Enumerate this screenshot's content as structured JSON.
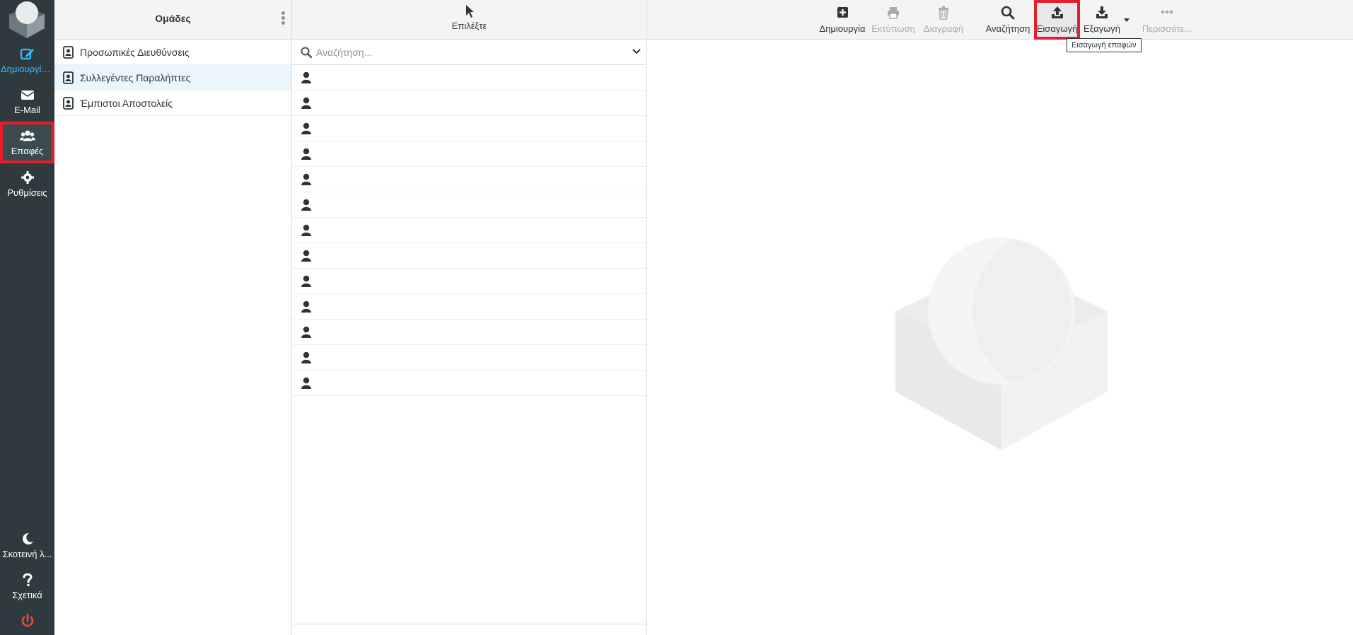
{
  "nav": {
    "items": [
      {
        "label": "Δημιουργία...",
        "icon": "compose-icon"
      },
      {
        "label": "E-Mail",
        "icon": "envelope-icon"
      },
      {
        "label": "Επαφές",
        "icon": "users-icon"
      },
      {
        "label": "Ρυθμίσεις",
        "icon": "gear-icon"
      }
    ],
    "bottom_items": [
      {
        "label": "Σκοτεινή λ...",
        "icon": "moon-icon"
      },
      {
        "label": "Σχετικά",
        "icon": "question-icon"
      },
      {
        "label": "",
        "icon": "power-icon"
      }
    ],
    "colors": {
      "background": "#2f3a3f",
      "accent": "#37beff",
      "highlight": "#e41e2a",
      "logout": "#e74c3c"
    }
  },
  "groups": {
    "title": "Ομάδες",
    "items": [
      {
        "label": "Προσωπικές Διευθύνσεις"
      },
      {
        "label": "Συλλεγέντες Παραλήπτες"
      },
      {
        "label": "Έμπιστοι Αποστολείς"
      }
    ],
    "selected_index": 1
  },
  "list": {
    "select_label": "Επιλέξτε",
    "search_placeholder": "Αναζήτηση...",
    "contacts": [
      "",
      "",
      "",
      "",
      "",
      "",
      "",
      "",
      "",
      "",
      "",
      "",
      ""
    ]
  },
  "toolbar": {
    "buttons": [
      {
        "label": "Δημιουργία",
        "icon": "plus-square-icon",
        "enabled": true
      },
      {
        "label": "Εκτύπωση",
        "icon": "printer-icon",
        "enabled": false
      },
      {
        "label": "Διαγραφή",
        "icon": "trash-icon",
        "enabled": false
      },
      {
        "label": "Αναζήτηση",
        "icon": "search-icon",
        "enabled": true
      },
      {
        "label": "Εισαγωγή",
        "icon": "upload-icon",
        "enabled": true
      },
      {
        "label": "Εξαγωγή",
        "icon": "download-icon",
        "enabled": true
      },
      {
        "label": "Περισσότε...",
        "icon": "more-icon",
        "enabled": false
      }
    ],
    "tooltip": "Εισαγωγή επαφών"
  }
}
